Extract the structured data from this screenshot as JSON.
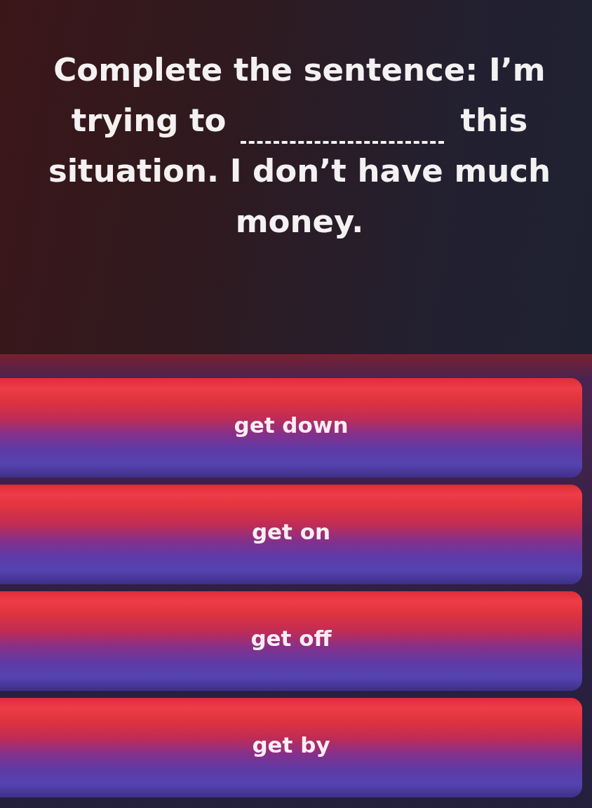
{
  "question": {
    "parts": [
      {
        "kind": "text",
        "text": "Complete the sentence: I’m"
      },
      {
        "kind": "text",
        "text": "trying to"
      },
      {
        "kind": "blank"
      },
      {
        "kind": "text",
        "text": "this"
      },
      {
        "kind": "text",
        "text": "situation. I don’t have much"
      },
      {
        "kind": "text",
        "text": "money."
      }
    ]
  },
  "options": [
    {
      "label": "get down"
    },
    {
      "label": "get on"
    },
    {
      "label": "get off"
    },
    {
      "label": "get by"
    }
  ]
}
